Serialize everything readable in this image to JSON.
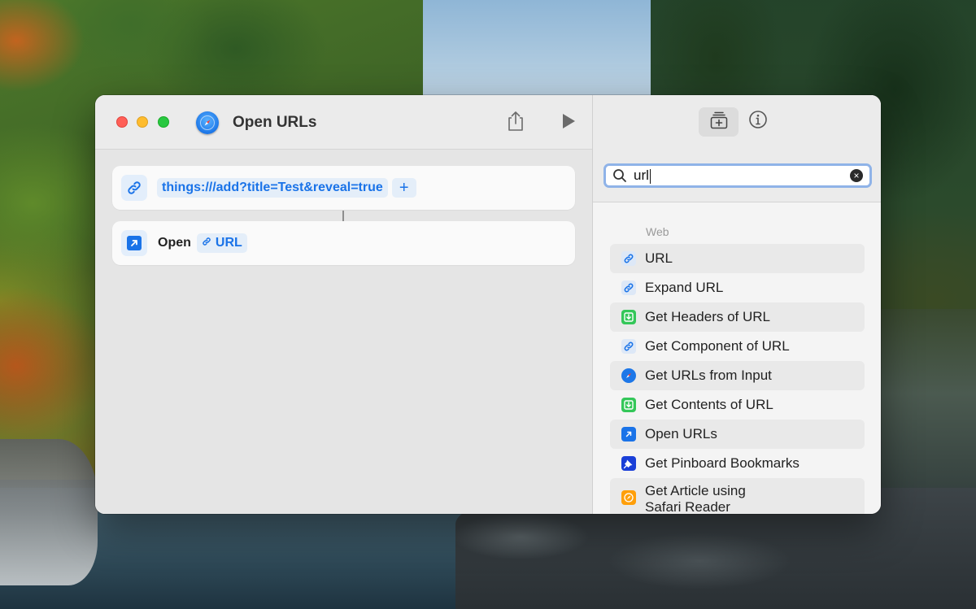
{
  "window": {
    "title": "Open URLs"
  },
  "editor": {
    "actions": [
      {
        "kind": "url",
        "value": "things:///add?title=Test&reveal=true",
        "add_label": "+"
      },
      {
        "kind": "open",
        "label": "Open",
        "variable": "URL"
      }
    ]
  },
  "sidebar": {
    "search": {
      "value": "url"
    },
    "section_title": "Web",
    "results": [
      {
        "label": "URL",
        "icon": "link-icon"
      },
      {
        "label": "Expand URL",
        "icon": "link-icon"
      },
      {
        "label": "Get Headers of URL",
        "icon": "download-icon"
      },
      {
        "label": "Get Component of URL",
        "icon": "link-icon"
      },
      {
        "label": "Get URLs from Input",
        "icon": "safari-icon"
      },
      {
        "label": "Get Contents of URL",
        "icon": "download-icon"
      },
      {
        "label": "Open URLs",
        "icon": "open-arrow-icon"
      },
      {
        "label": "Get Pinboard Bookmarks",
        "icon": "pin-icon"
      },
      {
        "label_line1": "Get Article using",
        "label_line2": "Safari Reader",
        "icon": "compass-icon"
      }
    ]
  },
  "colors": {
    "accent": "#1a73e8",
    "close": "#ff5f57",
    "minimize": "#febc2e",
    "maximize": "#28c840"
  }
}
